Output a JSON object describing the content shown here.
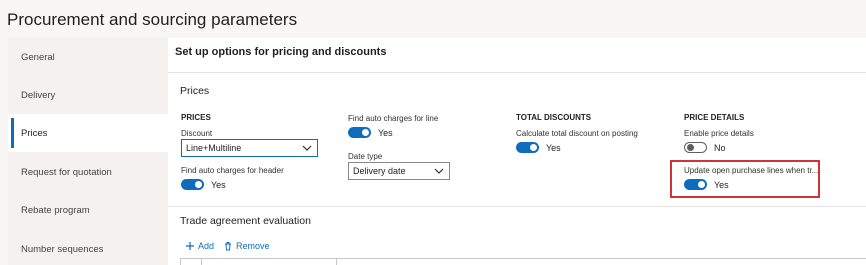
{
  "page": {
    "title": "Procurement and sourcing parameters"
  },
  "sidebar": {
    "items": [
      {
        "label": "General"
      },
      {
        "label": "Delivery"
      },
      {
        "label": "Prices"
      },
      {
        "label": "Request for quotation"
      },
      {
        "label": "Rebate program"
      },
      {
        "label": "Number sequences"
      }
    ],
    "active": "Prices"
  },
  "main": {
    "title": "Set up options for pricing and discounts",
    "prices_section": {
      "title": "Prices",
      "prices_group": {
        "heading": "PRICES",
        "discount_label": "Discount",
        "discount_value": "Line+Multiline",
        "auto_charges_header_label": "Find auto charges for header",
        "auto_charges_header_value": "Yes",
        "auto_charges_header_on": true
      },
      "middle_group": {
        "auto_charges_line_label": "Find auto charges for line",
        "auto_charges_line_value": "Yes",
        "auto_charges_line_on": true,
        "date_type_label": "Date type",
        "date_type_value": "Delivery date"
      },
      "total_discounts_group": {
        "heading": "TOTAL DISCOUNTS",
        "calc_label": "Calculate total discount on posting",
        "calc_value": "Yes",
        "calc_on": true
      },
      "price_details_group": {
        "heading": "PRICE DETAILS",
        "enable_label": "Enable price details",
        "enable_value": "No",
        "enable_on": false,
        "update_label": "Update open purchase lines when tr...",
        "update_value": "Yes",
        "update_on": true
      }
    },
    "trade_section": {
      "title": "Trade agreement evaluation",
      "add_label": "Add",
      "remove_label": "Remove"
    }
  },
  "colors": {
    "accent": "#0f6cbd",
    "highlight": "#d13438"
  },
  "icons": [
    "chevron-down-icon",
    "plus-icon",
    "trash-icon"
  ]
}
